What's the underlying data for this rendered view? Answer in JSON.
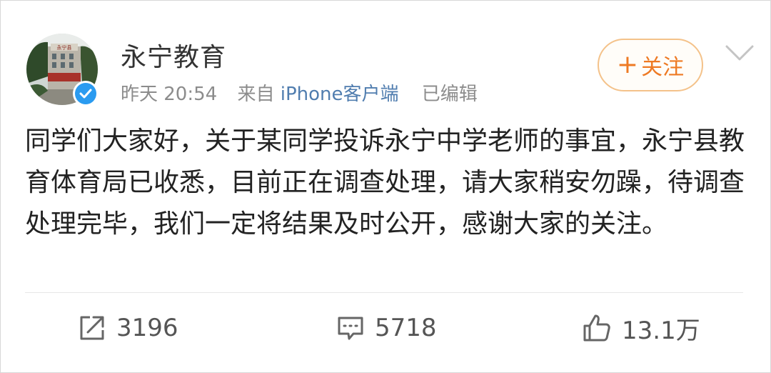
{
  "user": {
    "name": "永宁教育",
    "avatar_icon": "school-building-avatar",
    "verified_icon": "verified-badge-icon"
  },
  "meta": {
    "time": "昨天 20:54",
    "source_prefix": "来自",
    "source_app": "iPhone客户端",
    "edited": "已编辑"
  },
  "follow": {
    "plus": "+",
    "label": "关注"
  },
  "post": {
    "text": "同学们大家好，关于某同学投诉永宁中学老师的事宜，永宁县教育体育局已收悉，目前正在调查处理，请大家稍安勿躁，待调查处理完毕，我们一定将结果及时公开，感谢大家的关注。"
  },
  "actions": {
    "repost_count": "3196",
    "comment_count": "5718",
    "like_count": "13.1万"
  },
  "colors": {
    "accent_orange": "#ee7a24",
    "link_blue": "#507daf",
    "verified_blue": "#2a9bf0"
  }
}
